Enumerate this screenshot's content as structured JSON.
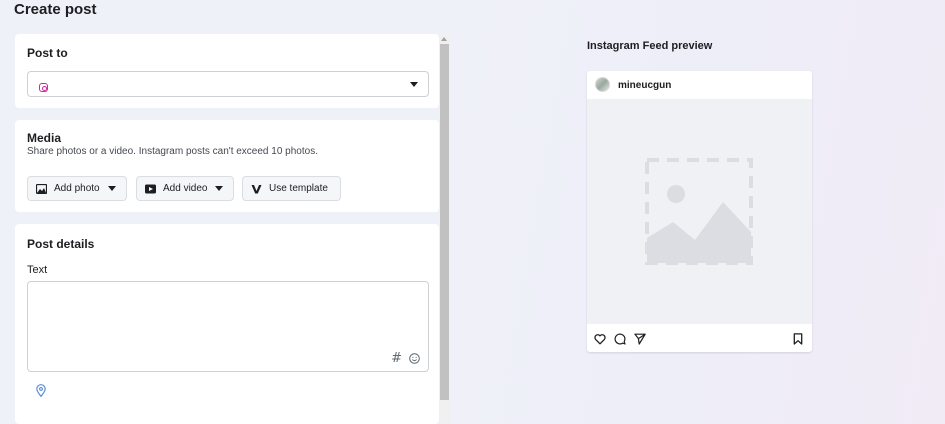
{
  "page": {
    "title": "Create post"
  },
  "post_to": {
    "title": "Post to",
    "selected_icon": "instagram-icon"
  },
  "media": {
    "title": "Media",
    "description": "Share photos or a video. Instagram posts can't exceed 10 photos.",
    "add_photo_label": "Add photo",
    "add_video_label": "Add video",
    "use_template_label": "Use template"
  },
  "post_details": {
    "title": "Post details",
    "text_label": "Text",
    "text_value": "",
    "hashtag_symbol": "#"
  },
  "preview": {
    "title": "Instagram Feed preview",
    "username": "mineucgun"
  },
  "colors": {
    "instagram": "#d6249f",
    "location_icon": "#5b8fd6",
    "placeholder": "#dcdde2"
  }
}
